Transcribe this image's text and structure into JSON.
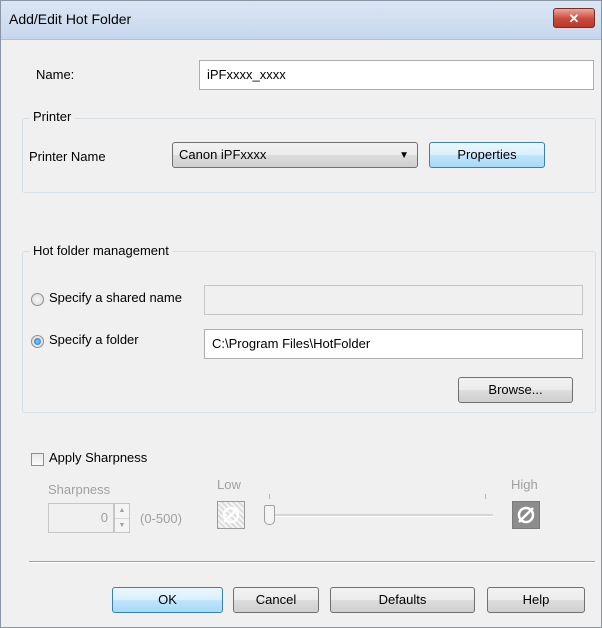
{
  "window": {
    "title": "Add/Edit Hot Folder",
    "close_glyph": "✕"
  },
  "name_field": {
    "label": "Name:",
    "value": "iPFxxxx_xxxx"
  },
  "printer_group": {
    "title": "Printer",
    "printer_name_label": "Printer Name",
    "printer_select_value": "Canon iPFxxxx",
    "properties_button": "Properties"
  },
  "hotfolder_group": {
    "title": "Hot folder management",
    "shared_name_label": "Specify a shared name",
    "shared_name_value": "",
    "folder_label": "Specify a folder",
    "folder_value": "C:\\Program Files\\HotFolder",
    "browse_button": "Browse...",
    "selected_option": "folder"
  },
  "sharpness": {
    "apply_label": "Apply Sharpness",
    "apply_checked": false,
    "sharpness_label": "Sharpness",
    "value": "0",
    "range_text": "(0-500)",
    "low_label": "Low",
    "high_label": "High",
    "slider_level": 0
  },
  "buttons": {
    "ok": "OK",
    "cancel": "Cancel",
    "defaults": "Defaults",
    "help": "Help"
  }
}
